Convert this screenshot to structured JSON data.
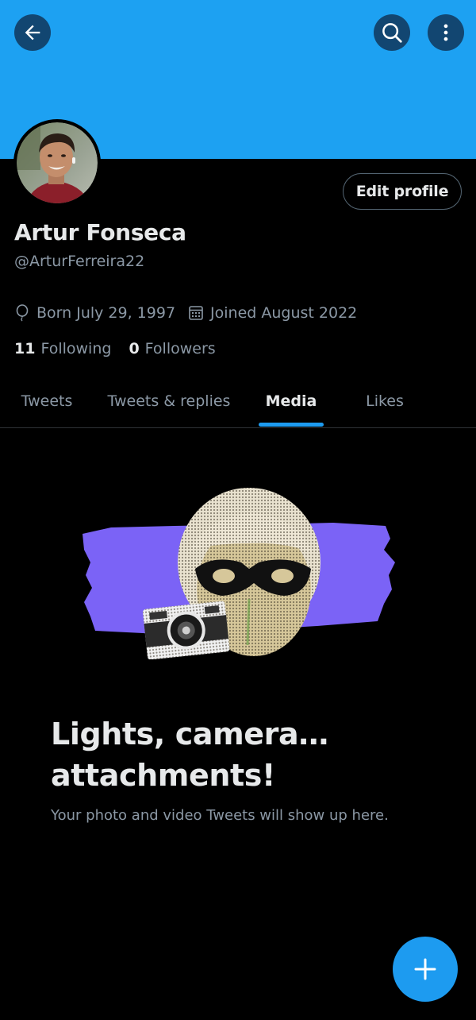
{
  "header": {
    "back_icon": "arrow-left-icon",
    "search_icon": "search-icon",
    "more_icon": "more-vertical-icon",
    "banner_color": "#1da1f2"
  },
  "profile": {
    "name": "Artur Fonseca",
    "handle": "@ArturFerreira22",
    "edit_label": "Edit profile",
    "birthday_icon": "balloon-icon",
    "birthday": "Born July 29, 1997",
    "joined_icon": "calendar-icon",
    "joined": "Joined August 2022",
    "following_count": "11",
    "following_label": "Following",
    "followers_count": "0",
    "followers_label": "Followers"
  },
  "tabs": [
    {
      "label": "Tweets",
      "active": false
    },
    {
      "label": "Tweets & replies",
      "active": false
    },
    {
      "label": "Media",
      "active": true
    },
    {
      "label": "Likes",
      "active": false
    }
  ],
  "empty_state": {
    "title_line1": "Lights, camera…",
    "title_line2": "attachments!",
    "subtitle": "Your photo and video Tweets will show up here."
  },
  "fab": {
    "icon": "plus-icon"
  },
  "colors": {
    "accent": "#1d9bf0",
    "background": "#000000",
    "text_primary": "#e7e9ea",
    "text_secondary": "#8b98a5"
  }
}
